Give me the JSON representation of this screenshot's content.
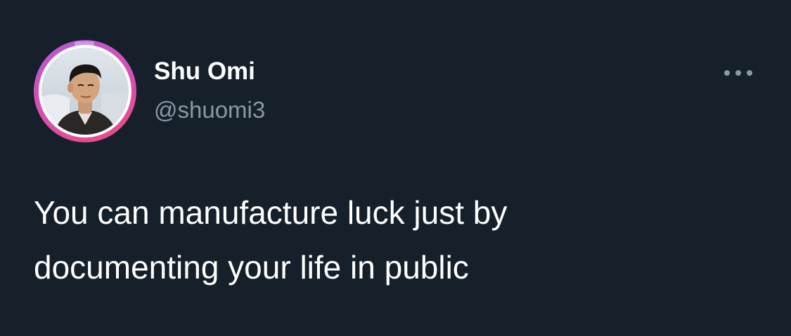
{
  "author": {
    "display_name": "Shu Omi",
    "handle": "@shuomi3",
    "avatar_icon": "profile-photo",
    "ring_colors": [
      "#b45bd6",
      "#d84fb0",
      "#ea4c7d"
    ]
  },
  "tweet": {
    "text_lines": [
      "You can manufacture luck just by",
      "documenting your life in public"
    ]
  },
  "actions": {
    "more_icon": "more-horizontal-icon"
  },
  "theme": {
    "background": "#15202b",
    "primary_text": "#ffffff",
    "secondary_text": "#8b98a5"
  }
}
